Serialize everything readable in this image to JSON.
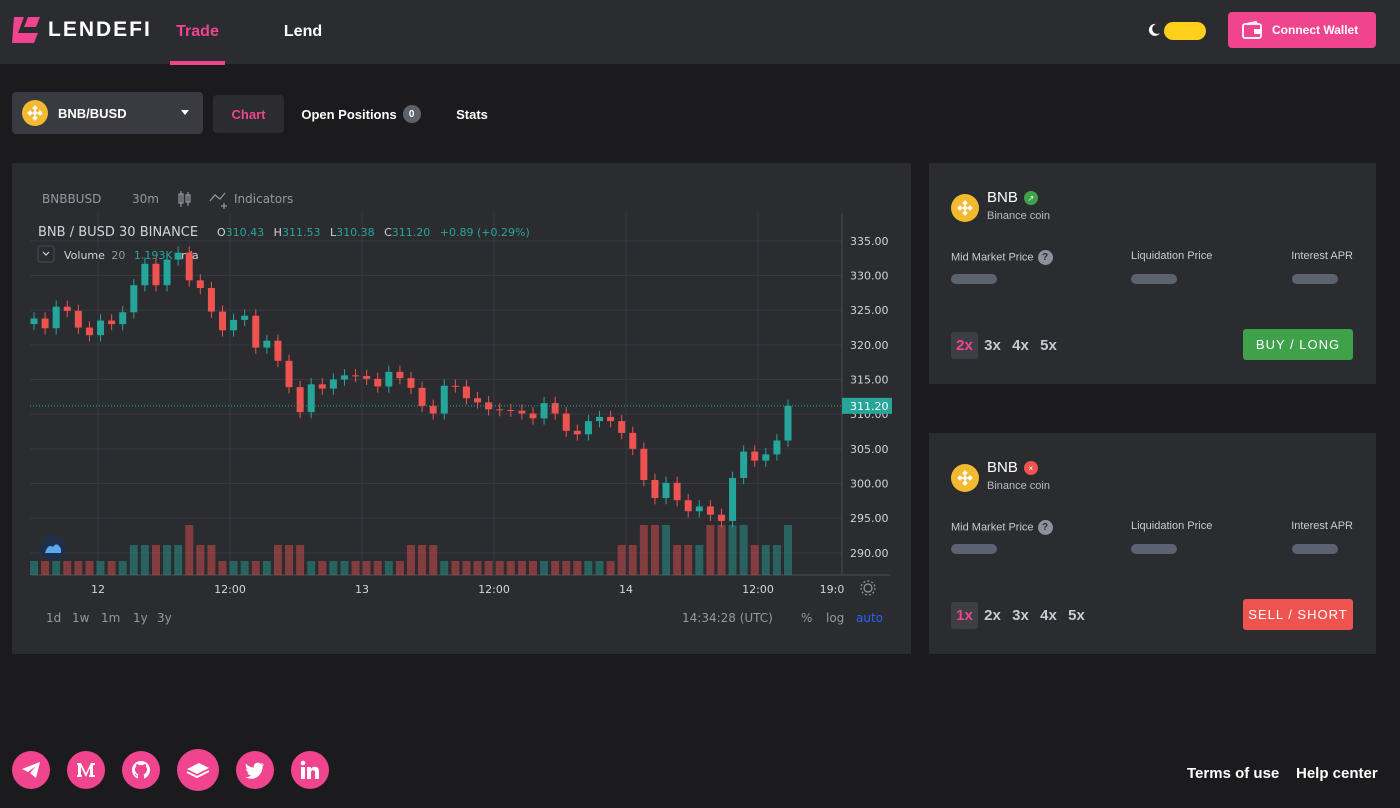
{
  "brand": {
    "name": "LENDEFI",
    "accent": "#f0448e"
  },
  "nav": {
    "trade": "Trade",
    "lend": "Lend"
  },
  "header": {
    "connect_label": "Connect Wallet"
  },
  "pair": {
    "label": "BNB/BUSD"
  },
  "tabs": {
    "chart": "Chart",
    "open_positions": "Open Positions",
    "open_count": "0",
    "stats": "Stats"
  },
  "chart": {
    "toolbar": {
      "symbol": "BNBBUSD",
      "interval": "30m",
      "indicators": "Indicators"
    },
    "legend": {
      "title": "BNB / BUSD  30  BINANCE",
      "o_label": "O",
      "o": "310.43",
      "h_label": "H",
      "h": "311.53",
      "l_label": "L",
      "l": "310.38",
      "c_label": "C",
      "c": "311.20",
      "change": "+0.89 (+0.29%)"
    },
    "volume_legend": {
      "label": "Volume",
      "period": "20",
      "value": "1.193K",
      "na": "n/a"
    },
    "ranges": [
      "1d",
      "1w",
      "1m",
      "1y",
      "3y"
    ],
    "clock": "14:34:28 (UTC)",
    "scale_opts": [
      "%",
      "log",
      "auto"
    ]
  },
  "chart_data": {
    "type": "candlestick",
    "x_ticks": [
      "12",
      "12:00",
      "13",
      "12:00",
      "14",
      "12:00",
      "19:0"
    ],
    "y_ticks": [
      335,
      330,
      325,
      320,
      315,
      310,
      305,
      300,
      295,
      290
    ],
    "ylim": [
      286.8,
      338.3
    ],
    "last_price": 311.2,
    "close": [
      323.8,
      322.4,
      325.5,
      324.9,
      322.5,
      321.4,
      323.5,
      323.0,
      324.7,
      328.6,
      331.7,
      328.6,
      332.3,
      333.3,
      329.3,
      328.2,
      324.8,
      322.1,
      323.6,
      324.2,
      319.6,
      320.6,
      317.7,
      313.9,
      310.3,
      314.3,
      313.7,
      315.0,
      315.6,
      315.5,
      315.1,
      314.0,
      316.1,
      315.2,
      313.8,
      311.2,
      310.1,
      314.1,
      314.0,
      312.3,
      311.7,
      310.7,
      310.6,
      310.5,
      310.1,
      309.4,
      311.6,
      310.1,
      307.6,
      307.1,
      309.0,
      309.6,
      309.0,
      307.3,
      305.0,
      300.5,
      297.9,
      300.1,
      297.6,
      296.0,
      296.7,
      295.5,
      294.6,
      300.8,
      304.6,
      303.3,
      304.2,
      306.2,
      311.2
    ],
    "volume_levels": [
      "low",
      "low",
      "low",
      "low",
      "low",
      "low",
      "low",
      "low",
      "low",
      "med",
      "med",
      "med",
      "med",
      "med",
      "high",
      "med",
      "med",
      "low",
      "low",
      "low",
      "low",
      "low",
      "med",
      "med",
      "med",
      "low",
      "low",
      "low",
      "low",
      "low",
      "low",
      "low",
      "low",
      "low",
      "med",
      "med",
      "med",
      "low",
      "low",
      "low",
      "low",
      "low",
      "low",
      "low",
      "low",
      "low",
      "low",
      "low",
      "low",
      "low",
      "low",
      "low",
      "low",
      "med",
      "med",
      "high",
      "high",
      "high",
      "med",
      "med",
      "med",
      "high",
      "high",
      "high",
      "high",
      "med",
      "med",
      "med",
      "high"
    ]
  },
  "positions": [
    {
      "symbol": "BNB",
      "name": "Binance coin",
      "dot_color": "#3fa24a",
      "dot_glyph": "↗",
      "mid_label": "Mid Market Price",
      "liq_label": "Liquidation Price",
      "apr_label": "Interest APR",
      "leverages": [
        "2x",
        "3x",
        "4x",
        "5x"
      ],
      "selected": "2x",
      "action": "BUY / LONG"
    },
    {
      "symbol": "BNB",
      "name": "Binance coin",
      "dot_color": "#ef5350",
      "dot_glyph": "×",
      "mid_label": "Mid Market Price",
      "liq_label": "Liquidation Price",
      "apr_label": "Interest APR",
      "leverages": [
        "1x",
        "2x",
        "3x",
        "4x",
        "5x"
      ],
      "selected": "1x",
      "action": "SELL / SHORT"
    }
  ],
  "footer": {
    "terms": "Terms of use",
    "help": "Help center"
  },
  "social": [
    "telegram-icon",
    "medium-icon",
    "github-icon",
    "book-icon",
    "twitter-icon",
    "linkedin-icon"
  ]
}
